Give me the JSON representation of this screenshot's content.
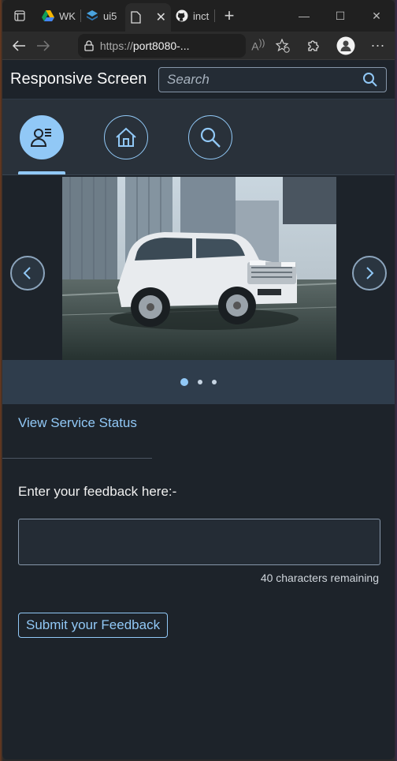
{
  "browser": {
    "tabs": [
      {
        "label": "WK",
        "icon": "drive-icon"
      },
      {
        "label": "ui5",
        "icon": "ui5-icon"
      },
      {
        "label": "",
        "icon": "page-icon",
        "active": true
      },
      {
        "label": "inct",
        "icon": "github-icon"
      }
    ],
    "address": {
      "scheme": "https://",
      "host": "port8080-..."
    }
  },
  "app": {
    "title": "Responsive Screen",
    "search": {
      "placeholder": "Search"
    },
    "nav_icons": [
      {
        "name": "user-list-icon",
        "selected": true
      },
      {
        "name": "home-icon",
        "selected": false
      },
      {
        "name": "search-icon",
        "selected": false
      }
    ],
    "carousel": {
      "pages": 3,
      "active_page": 1
    },
    "service_link": "View Service Status",
    "feedback": {
      "label": "Enter your feedback here:-",
      "value": "",
      "counter": "40 characters remaining",
      "submit_label": "Submit your Feedback"
    }
  },
  "colors": {
    "accent": "#91c8f6",
    "background": "#1d232a",
    "shell": "#29313a"
  }
}
